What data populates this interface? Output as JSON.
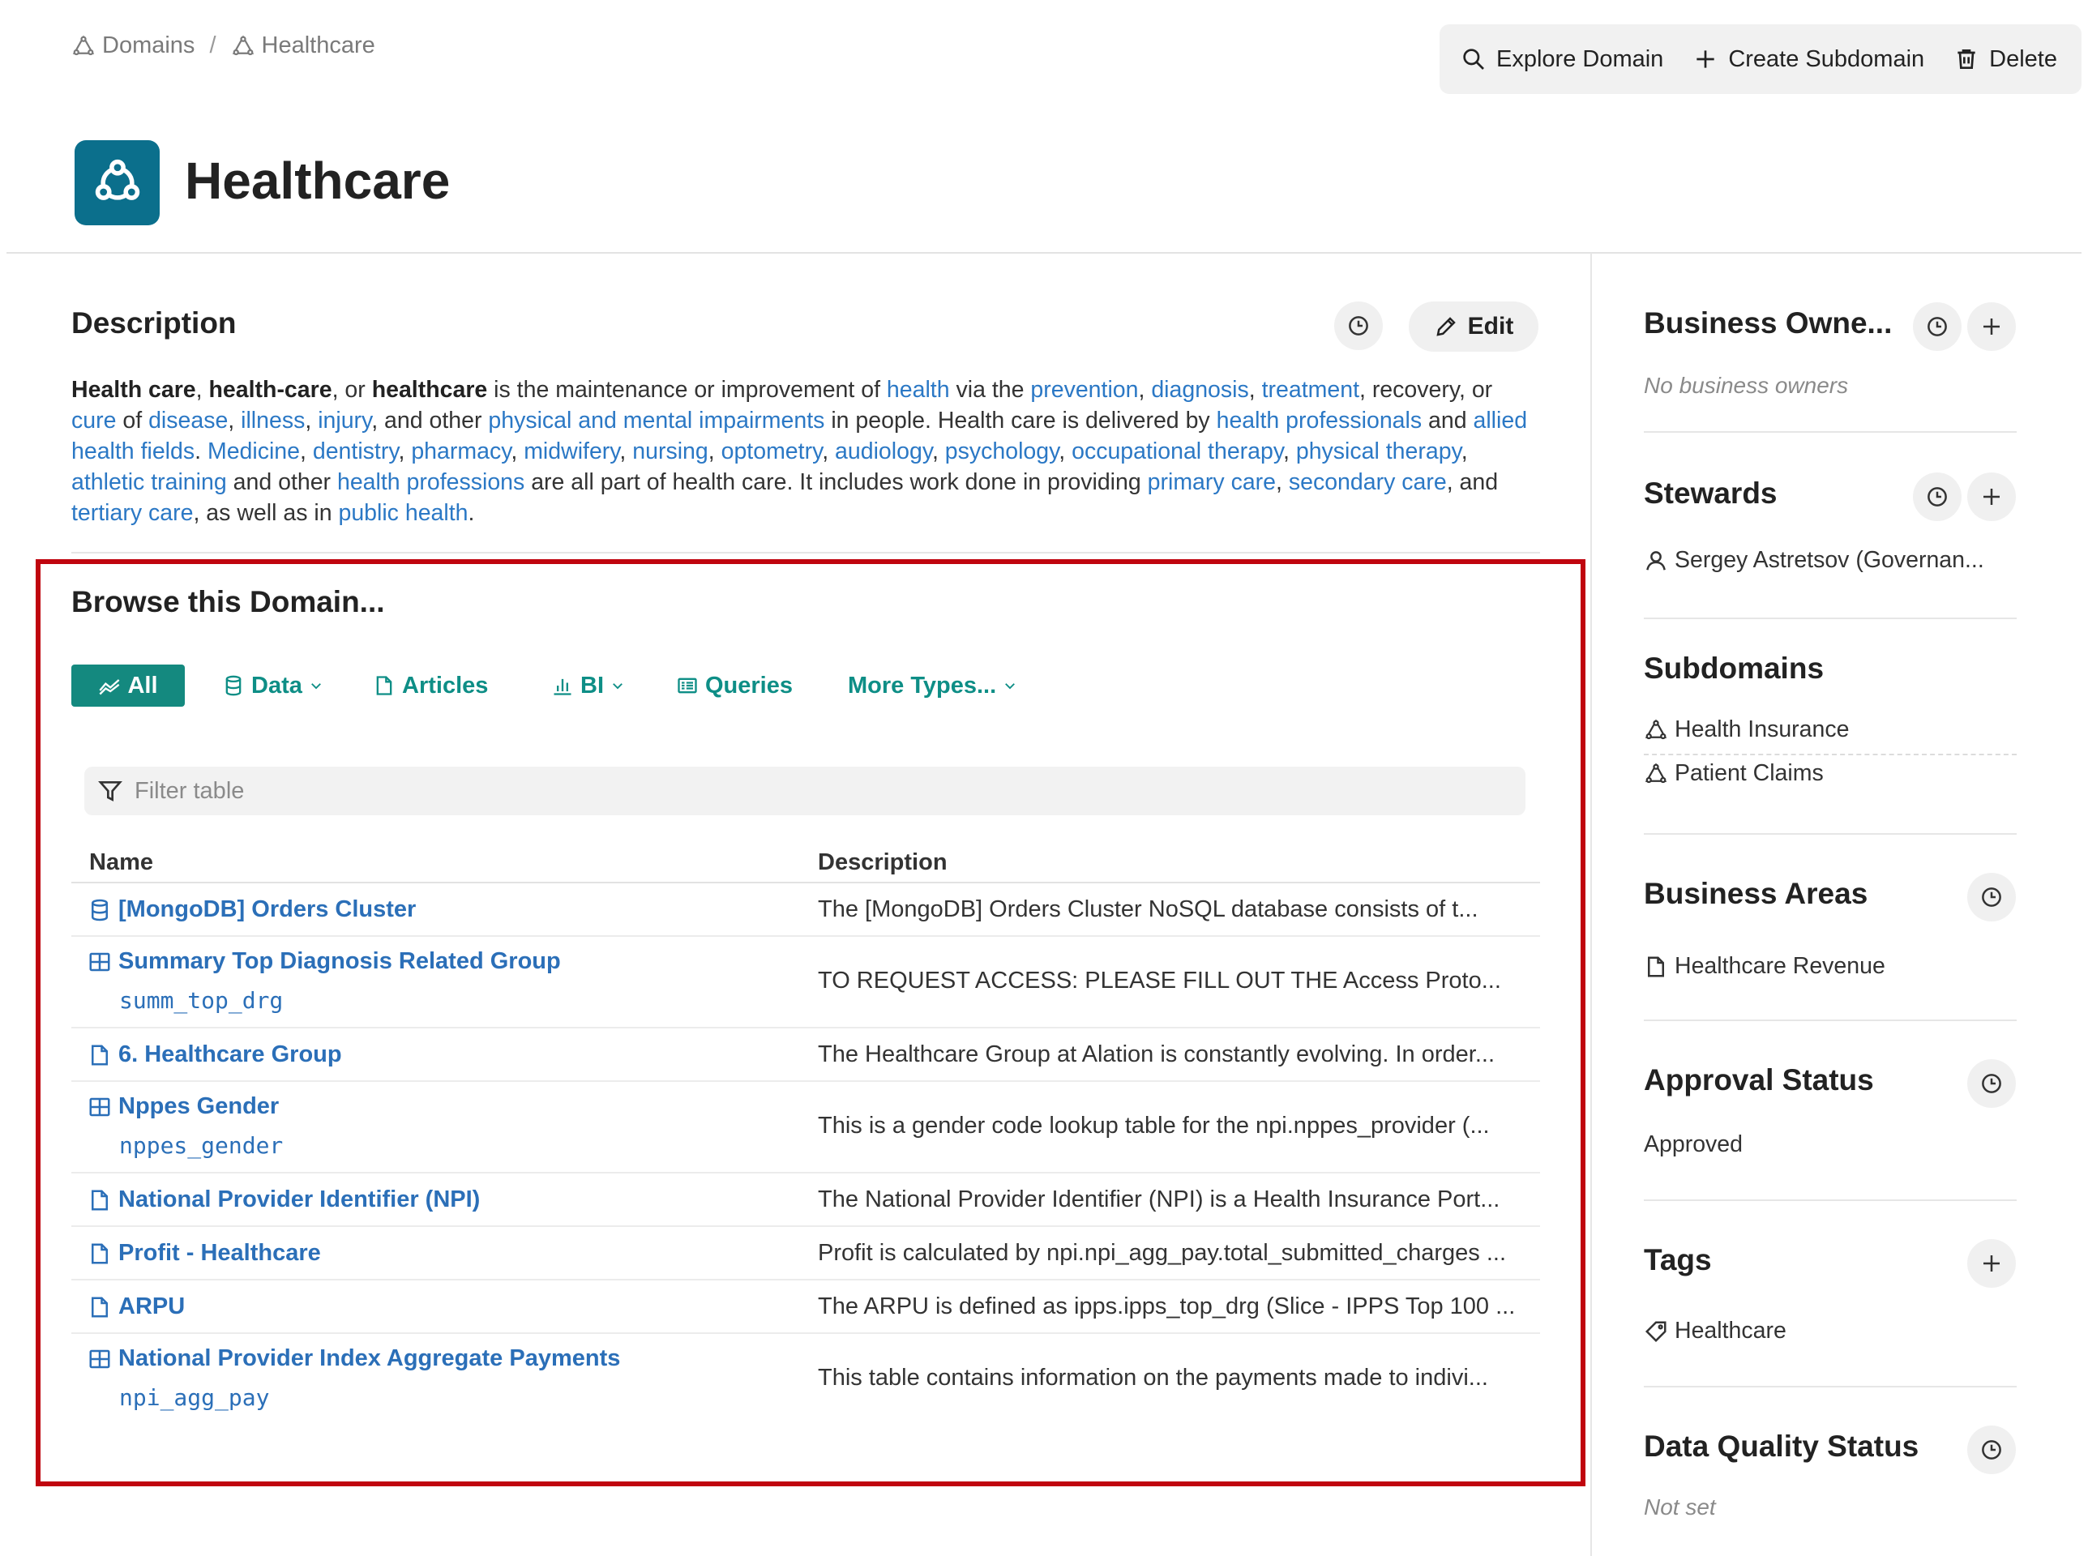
{
  "breadcrumb": [
    {
      "label": "Domains",
      "icon": "domain-icon"
    },
    {
      "label": "Healthcare",
      "icon": "domain-icon"
    }
  ],
  "breadcrumb_separator": "/",
  "actions": {
    "explore": "Explore Domain",
    "create_subdomain": "Create Subdomain",
    "delete": "Delete"
  },
  "page": {
    "title": "Healthcare",
    "logo_color": "#0b6f8c"
  },
  "description": {
    "title": "Description",
    "edit_label": "Edit",
    "segments": [
      {
        "t": "Health care",
        "s": "b"
      },
      {
        "t": ", ",
        "s": ""
      },
      {
        "t": "health-care",
        "s": "b"
      },
      {
        "t": ", or ",
        "s": ""
      },
      {
        "t": "healthcare",
        "s": "b"
      },
      {
        "t": " is the maintenance or improvement of ",
        "s": ""
      },
      {
        "t": "health",
        "s": "l"
      },
      {
        "t": " via the ",
        "s": ""
      },
      {
        "t": "prevention",
        "s": "l"
      },
      {
        "t": ", ",
        "s": ""
      },
      {
        "t": "diagnosis",
        "s": "l"
      },
      {
        "t": ", ",
        "s": ""
      },
      {
        "t": "treatment",
        "s": "l"
      },
      {
        "t": ", recovery, or ",
        "s": ""
      },
      {
        "t": "cure",
        "s": "l"
      },
      {
        "t": " of ",
        "s": ""
      },
      {
        "t": "disease",
        "s": "l"
      },
      {
        "t": ", ",
        "s": ""
      },
      {
        "t": "illness",
        "s": "l"
      },
      {
        "t": ", ",
        "s": ""
      },
      {
        "t": "injury",
        "s": "l"
      },
      {
        "t": ", and other ",
        "s": ""
      },
      {
        "t": "physical and mental impairments",
        "s": "l"
      },
      {
        "t": " in people. Health care is delivered by ",
        "s": ""
      },
      {
        "t": "health professionals",
        "s": "l"
      },
      {
        "t": " and ",
        "s": ""
      },
      {
        "t": "allied health fields",
        "s": "l"
      },
      {
        "t": ". ",
        "s": ""
      },
      {
        "t": "Medicine",
        "s": "l"
      },
      {
        "t": ", ",
        "s": ""
      },
      {
        "t": "dentistry",
        "s": "l"
      },
      {
        "t": ", ",
        "s": ""
      },
      {
        "t": "pharmacy",
        "s": "l"
      },
      {
        "t": ", ",
        "s": ""
      },
      {
        "t": "midwifery",
        "s": "l"
      },
      {
        "t": ", ",
        "s": ""
      },
      {
        "t": "nursing",
        "s": "l"
      },
      {
        "t": ", ",
        "s": ""
      },
      {
        "t": "optometry",
        "s": "l"
      },
      {
        "t": ", ",
        "s": ""
      },
      {
        "t": "audiology",
        "s": "l"
      },
      {
        "t": ", ",
        "s": ""
      },
      {
        "t": "psychology",
        "s": "l"
      },
      {
        "t": ", ",
        "s": ""
      },
      {
        "t": "occupational therapy",
        "s": "l"
      },
      {
        "t": ", ",
        "s": ""
      },
      {
        "t": "physical therapy",
        "s": "l"
      },
      {
        "t": ", ",
        "s": ""
      },
      {
        "t": "athletic training",
        "s": "l"
      },
      {
        "t": " and other ",
        "s": ""
      },
      {
        "t": "health professions",
        "s": "l"
      },
      {
        "t": " are all part of health care. It includes work done in providing ",
        "s": ""
      },
      {
        "t": "primary care",
        "s": "l"
      },
      {
        "t": ", ",
        "s": ""
      },
      {
        "t": "secondary care",
        "s": "l"
      },
      {
        "t": ", and ",
        "s": ""
      },
      {
        "t": "tertiary care",
        "s": "l"
      },
      {
        "t": ", as well as in ",
        "s": ""
      },
      {
        "t": "public health",
        "s": "l"
      },
      {
        "t": ".",
        "s": ""
      }
    ]
  },
  "browse": {
    "title": "Browse this Domain...",
    "tabs": {
      "all": "All",
      "data": "Data",
      "articles": "Articles",
      "bi": "BI",
      "queries": "Queries",
      "more": "More Types..."
    },
    "filter_placeholder": "Filter table",
    "columns": {
      "name": "Name",
      "description": "Description"
    },
    "rows": [
      {
        "icon": "database-icon",
        "name": "[MongoDB] Orders Cluster",
        "code": "",
        "description": "The [MongoDB] Orders Cluster   NoSQL database consists of t..."
      },
      {
        "icon": "table-icon",
        "name": "Summary Top Diagnosis Related Group",
        "code": "summ_top_drg",
        "description": "TO REQUEST ACCESS: PLEASE FILL OUT THE Access Proto..."
      },
      {
        "icon": "article-icon",
        "name": "6. Healthcare Group",
        "code": "",
        "description": "The Healthcare Group at Alation is constantly evolving. In order..."
      },
      {
        "icon": "table-icon",
        "name": "Nppes Gender",
        "code": "nppes_gender",
        "description": "This is a gender code lookup table for the npi.nppes_provider (..."
      },
      {
        "icon": "article-icon",
        "name": "National Provider Identifier (NPI)",
        "code": "",
        "description": "The National Provider Identifier (NPI) is a Health Insurance Port..."
      },
      {
        "icon": "article-icon",
        "name": "Profit - Healthcare",
        "code": "",
        "description": "Profit is calculated by npi.npi_agg_pay.total_submitted_charges ..."
      },
      {
        "icon": "article-icon",
        "name": "ARPU",
        "code": "",
        "description": "The ARPU is defined as ipps.ipps_top_drg (Slice - IPPS Top 100 ..."
      },
      {
        "icon": "table-icon",
        "name": "National Provider Index Aggregate Payments",
        "code": "npi_agg_pay",
        "description": "This table contains information on the payments made to indivi..."
      }
    ]
  },
  "sidebar": {
    "business_owners": {
      "title": "Business Owne...",
      "empty": "No business owners"
    },
    "stewards": {
      "title": "Stewards",
      "items": [
        "Sergey Astretsov (Governan..."
      ]
    },
    "subdomains": {
      "title": "Subdomains",
      "items": [
        "Health Insurance",
        "Patient Claims"
      ]
    },
    "business_areas": {
      "title": "Business Areas",
      "items": [
        "Healthcare Revenue"
      ]
    },
    "approval_status": {
      "title": "Approval Status",
      "value": "Approved"
    },
    "tags": {
      "title": "Tags",
      "items": [
        "Healthcare"
      ]
    },
    "data_quality_status": {
      "title": "Data Quality Status",
      "value": "Not set"
    }
  },
  "colors": {
    "accent_teal": "#14897f",
    "link_blue": "#2b78c5",
    "highlight_red": "#c0050f"
  }
}
